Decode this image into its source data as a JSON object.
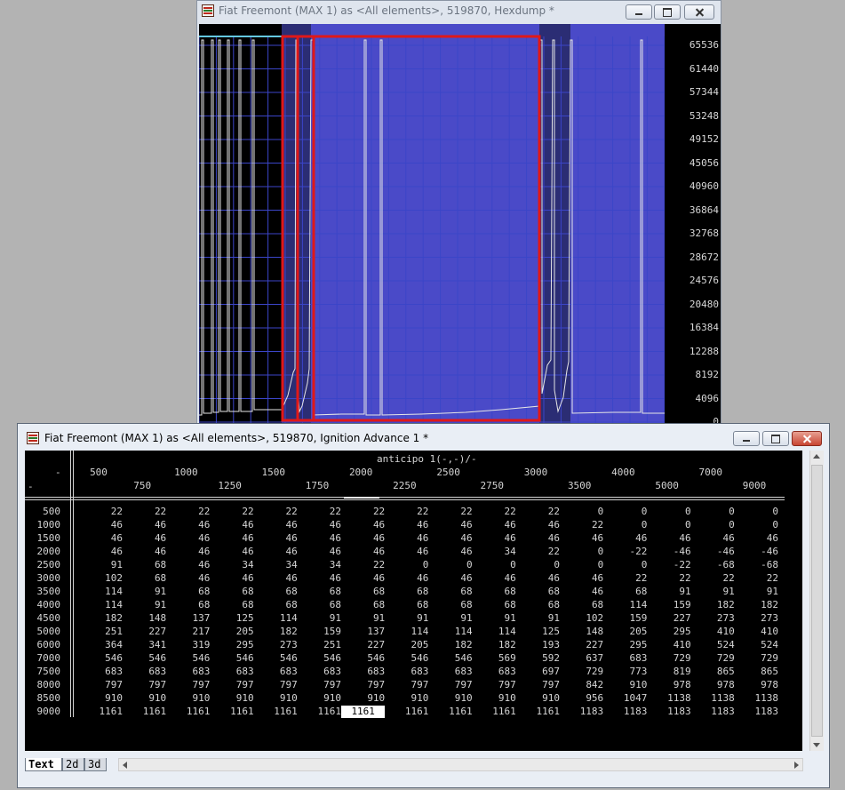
{
  "hexdump_window": {
    "title": "Fiat Freemont (MAX 1) as <All elements>, 519870, Hexdump *",
    "y_ticks": [
      "65536",
      "61440",
      "57344",
      "53248",
      "49152",
      "45056",
      "40960",
      "36864",
      "32768",
      "28672",
      "24576",
      "20480",
      "16384",
      "12288",
      "8192",
      "4096",
      "0"
    ]
  },
  "ignition_window": {
    "title": "Fiat Freemont (MAX 1) as <All elements>, 519870, Ignition Advance 1 *",
    "map_title": "anticipo 1(-,-)/-",
    "corner_top": "-",
    "corner_bottom": "-",
    "columns": [
      500,
      750,
      1000,
      1250,
      1500,
      1750,
      2000,
      2250,
      2500,
      2750,
      3000,
      3500,
      4000,
      5000,
      7000,
      9000
    ],
    "rows": [
      500,
      1000,
      1500,
      2000,
      2500,
      3000,
      3500,
      4000,
      4500,
      5000,
      6000,
      7000,
      7500,
      8000,
      8500,
      9000
    ],
    "values": [
      [
        22,
        22,
        22,
        22,
        22,
        22,
        22,
        22,
        22,
        22,
        22,
        0,
        0,
        0,
        0,
        0
      ],
      [
        46,
        46,
        46,
        46,
        46,
        46,
        46,
        46,
        46,
        46,
        46,
        22,
        0,
        0,
        0,
        0
      ],
      [
        46,
        46,
        46,
        46,
        46,
        46,
        46,
        46,
        46,
        46,
        46,
        46,
        46,
        46,
        46,
        46
      ],
      [
        46,
        46,
        46,
        46,
        46,
        46,
        46,
        46,
        46,
        34,
        22,
        0,
        -22,
        -46,
        -46,
        -46
      ],
      [
        91,
        68,
        46,
        34,
        34,
        34,
        22,
        0,
        0,
        0,
        0,
        0,
        0,
        -22,
        -68,
        -68
      ],
      [
        102,
        68,
        46,
        46,
        46,
        46,
        46,
        46,
        46,
        46,
        46,
        46,
        22,
        22,
        22,
        22
      ],
      [
        114,
        91,
        68,
        68,
        68,
        68,
        68,
        68,
        68,
        68,
        68,
        46,
        68,
        91,
        91,
        91
      ],
      [
        114,
        91,
        68,
        68,
        68,
        68,
        68,
        68,
        68,
        68,
        68,
        68,
        114,
        159,
        182,
        182
      ],
      [
        182,
        148,
        137,
        125,
        114,
        91,
        91,
        91,
        91,
        91,
        91,
        102,
        159,
        227,
        273,
        273
      ],
      [
        251,
        227,
        217,
        205,
        182,
        159,
        137,
        114,
        114,
        114,
        125,
        148,
        205,
        295,
        410,
        410
      ],
      [
        364,
        341,
        319,
        295,
        273,
        251,
        227,
        205,
        182,
        182,
        193,
        227,
        295,
        410,
        524,
        524
      ],
      [
        546,
        546,
        546,
        546,
        546,
        546,
        546,
        546,
        546,
        569,
        592,
        637,
        683,
        729,
        729,
        729
      ],
      [
        683,
        683,
        683,
        683,
        683,
        683,
        683,
        683,
        683,
        683,
        697,
        729,
        773,
        819,
        865,
        865
      ],
      [
        797,
        797,
        797,
        797,
        797,
        797,
        797,
        797,
        797,
        797,
        797,
        842,
        910,
        978,
        978,
        978
      ],
      [
        910,
        910,
        910,
        910,
        910,
        910,
        910,
        910,
        910,
        910,
        910,
        956,
        1047,
        1138,
        1138,
        1138
      ],
      [
        1161,
        1161,
        1161,
        1161,
        1161,
        1161,
        1161,
        1161,
        1161,
        1161,
        1161,
        1183,
        1183,
        1183,
        1183,
        1183
      ]
    ],
    "selected_cell": {
      "row": 15,
      "col": 6
    },
    "tabs": [
      "Text",
      "2d",
      "3d"
    ],
    "active_tab": "Text"
  },
  "colors": {
    "desktop": "#b3b3b3",
    "plot_background": "#000000",
    "grid": "#3b45c8",
    "highlight_region": "#4a4ac8",
    "selection_frame": "#e01818",
    "selected_cell_bg": "#ffffff"
  },
  "icons": {
    "window_icon": "hex-editor-icon",
    "minimize": "minimize-icon",
    "maximize": "maximize-icon",
    "close": "close-icon"
  }
}
